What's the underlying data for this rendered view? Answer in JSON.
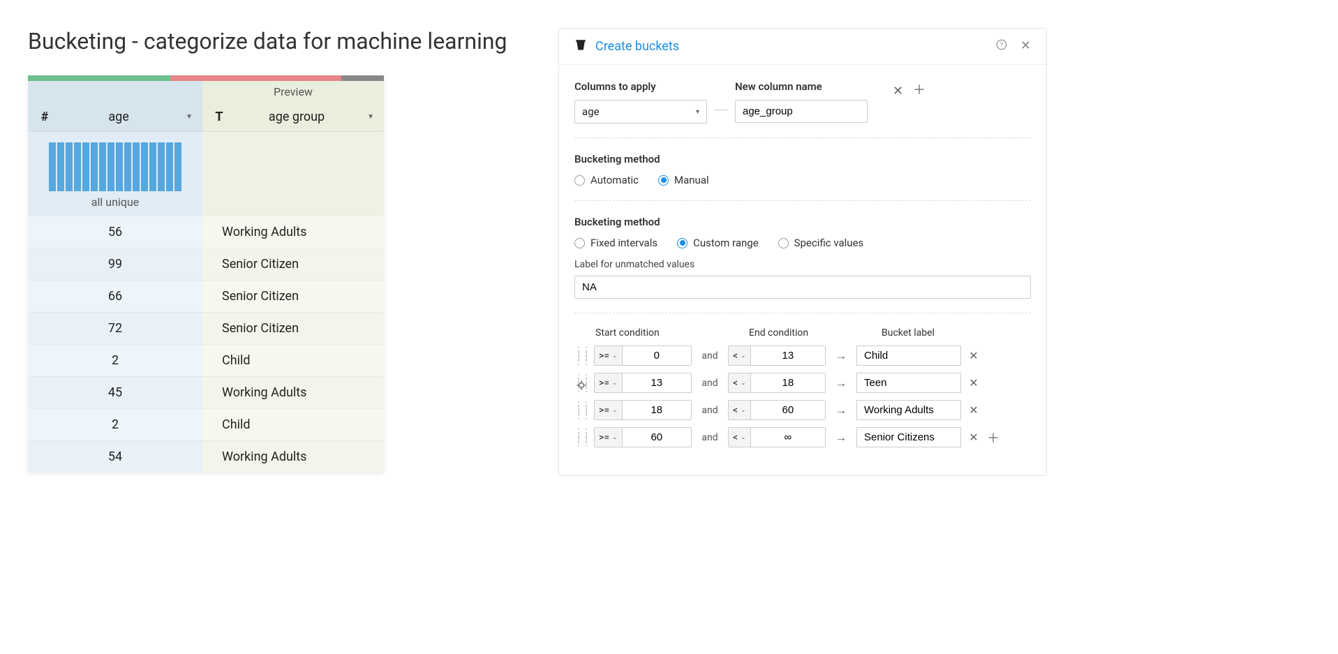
{
  "page": {
    "title": "Bucketing - categorize data for machine learning"
  },
  "table": {
    "preview_label": "Preview",
    "columns": {
      "age": {
        "label": "age",
        "type_icon": "#"
      },
      "age_group": {
        "label": "age group",
        "type_icon": "T"
      }
    },
    "histogram_caption": "all unique",
    "rows": [
      {
        "age": "56",
        "group": "Working Adults"
      },
      {
        "age": "99",
        "group": "Senior Citizen"
      },
      {
        "age": "66",
        "group": "Senior Citizen"
      },
      {
        "age": "72",
        "group": "Senior Citizen"
      },
      {
        "age": "2",
        "group": "Child"
      },
      {
        "age": "45",
        "group": "Working Adults"
      },
      {
        "age": "2",
        "group": "Child"
      },
      {
        "age": "54",
        "group": "Working Adults"
      }
    ]
  },
  "panel": {
    "title": "Create buckets",
    "columns_to_apply_label": "Columns to apply",
    "columns_to_apply_value": "age",
    "new_column_label": "New column name",
    "new_column_value": "age_group",
    "method_label": "Bucketing method",
    "method_options": {
      "automatic": "Automatic",
      "manual": "Manual"
    },
    "method_selected": "manual",
    "range_label": "Bucketing method",
    "range_options": {
      "fixed": "Fixed intervals",
      "custom": "Custom range",
      "specific": "Specific values"
    },
    "range_selected": "custom",
    "unmatched_label": "Label for unmatched values",
    "unmatched_value": "NA",
    "bucket_headers": {
      "start": "Start condition",
      "end": "End condition",
      "label": "Bucket label"
    },
    "and_text": "and",
    "arrow": "→",
    "buckets": [
      {
        "start_op": ">=",
        "start_val": "0",
        "end_op": "<",
        "end_val": "13",
        "label": "Child"
      },
      {
        "start_op": ">=",
        "start_val": "13",
        "end_op": "<",
        "end_val": "18",
        "label": "Teen"
      },
      {
        "start_op": ">=",
        "start_val": "18",
        "end_op": "<",
        "end_val": "60",
        "label": "Working Adults"
      },
      {
        "start_op": ">=",
        "start_val": "60",
        "end_op": "<",
        "end_val": "∞",
        "label": "Senior Citizens"
      }
    ]
  }
}
